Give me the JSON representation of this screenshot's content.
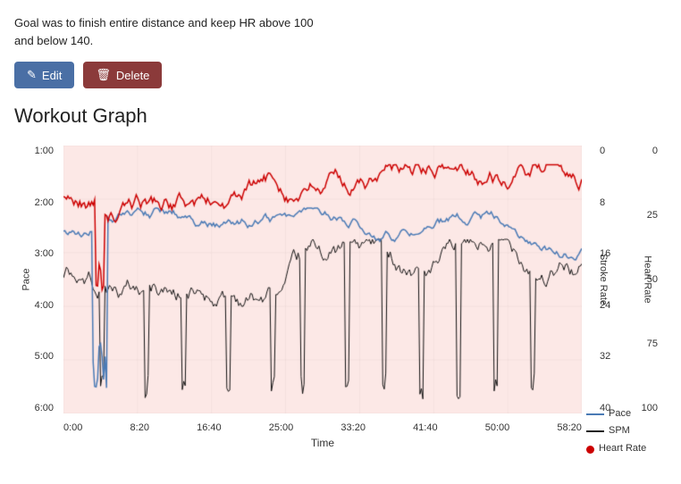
{
  "page": {
    "goal_text": "Goal was to finish entire distance and keep HR above 100\nand below 140.",
    "edit_button": "Edit",
    "delete_button": "Delete",
    "section_title": "Workout Graph",
    "chart": {
      "x_labels": [
        "0:00",
        "8:20",
        "16:40",
        "25:00",
        "33:20",
        "41:40",
        "50:00",
        "58:20"
      ],
      "x_axis_label": "Time",
      "y_left_labels": [
        "1:00",
        "2:00",
        "3:00",
        "4:00",
        "5:00",
        "6:00"
      ],
      "y_right_sr_labels": [
        "0",
        "8",
        "16",
        "24",
        "32",
        "40"
      ],
      "y_right_hr_labels": [
        "0",
        "25",
        "50",
        "75",
        "100"
      ],
      "y_left_axis_label": "Pace",
      "y_right_sr_axis_label": "Stroke Rate",
      "y_right_hr_axis_label": "Heart Rate",
      "legend": [
        {
          "label": "Pace",
          "type": "line",
          "color": "#4a7ab5"
        },
        {
          "label": "SPM",
          "type": "line",
          "color": "#222222"
        },
        {
          "label": "Heart Rate",
          "type": "dot",
          "color": "#cc0000"
        }
      ]
    }
  }
}
